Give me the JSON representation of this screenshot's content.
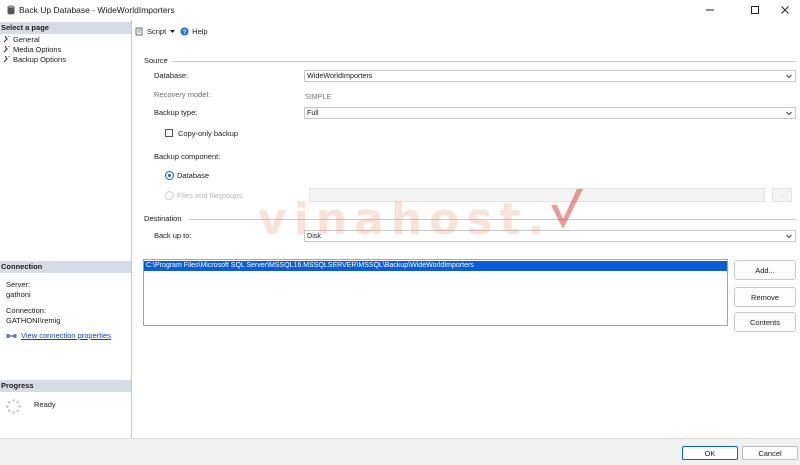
{
  "window": {
    "title": "Back Up Database - WideWorldImporters",
    "controls": {
      "minimize": "minimize",
      "maximize": "maximize",
      "close": "close"
    }
  },
  "left_pane": {
    "select_page_header": "Select a page",
    "pages": [
      "General",
      "Media Options",
      "Backup Options"
    ],
    "connection_header": "Connection",
    "server_label": "Server:",
    "server_value": "gathoni",
    "connection_label": "Connection:",
    "connection_value": "GATHONI\\remig",
    "view_props_link": "View connection properties",
    "progress_header": "Progress",
    "progress_status": "Ready"
  },
  "toolbar": {
    "script_label": "Script",
    "help_label": "Help"
  },
  "source": {
    "group_title": "Source",
    "database_label": "Database:",
    "database_value": "WideWorldImporters",
    "recovery_label": "Recovery model:",
    "recovery_value": "SIMPLE",
    "backup_type_label": "Backup type:",
    "backup_type_value": "Full",
    "copy_only_label": "Copy-only backup",
    "copy_only_checked": false,
    "component_label": "Backup component:",
    "component_database_label": "Database",
    "component_files_label": "Files and filegroups:",
    "component_selected": "Database",
    "browse_label": "..."
  },
  "destination": {
    "group_title": "Destination",
    "back_up_to_label": "Back up to:",
    "back_up_to_value": "Disk",
    "paths": [
      "C:\\Program Files\\Microsoft SQL Server\\MSSQL16.MSSQLSERVER\\MSSQL\\Backup\\WideWorldImporters"
    ],
    "add_label": "Add...",
    "remove_label": "Remove",
    "contents_label": "Contents"
  },
  "footer": {
    "ok_label": "OK",
    "cancel_label": "Cancel"
  },
  "watermark": {
    "text": "vinahost."
  },
  "colors": {
    "accent": "#0b5ed7",
    "section_header_bg": "#d6dce6",
    "link": "#0b47b0",
    "list_border": "#e08b8b"
  },
  "icons": {
    "app": "database-icon",
    "page": "wrench-icon",
    "script": "script-icon",
    "help": "help-icon",
    "connection": "connection-properties-icon",
    "progress": "spinner-icon",
    "dropdown": "chevron-down-icon"
  }
}
